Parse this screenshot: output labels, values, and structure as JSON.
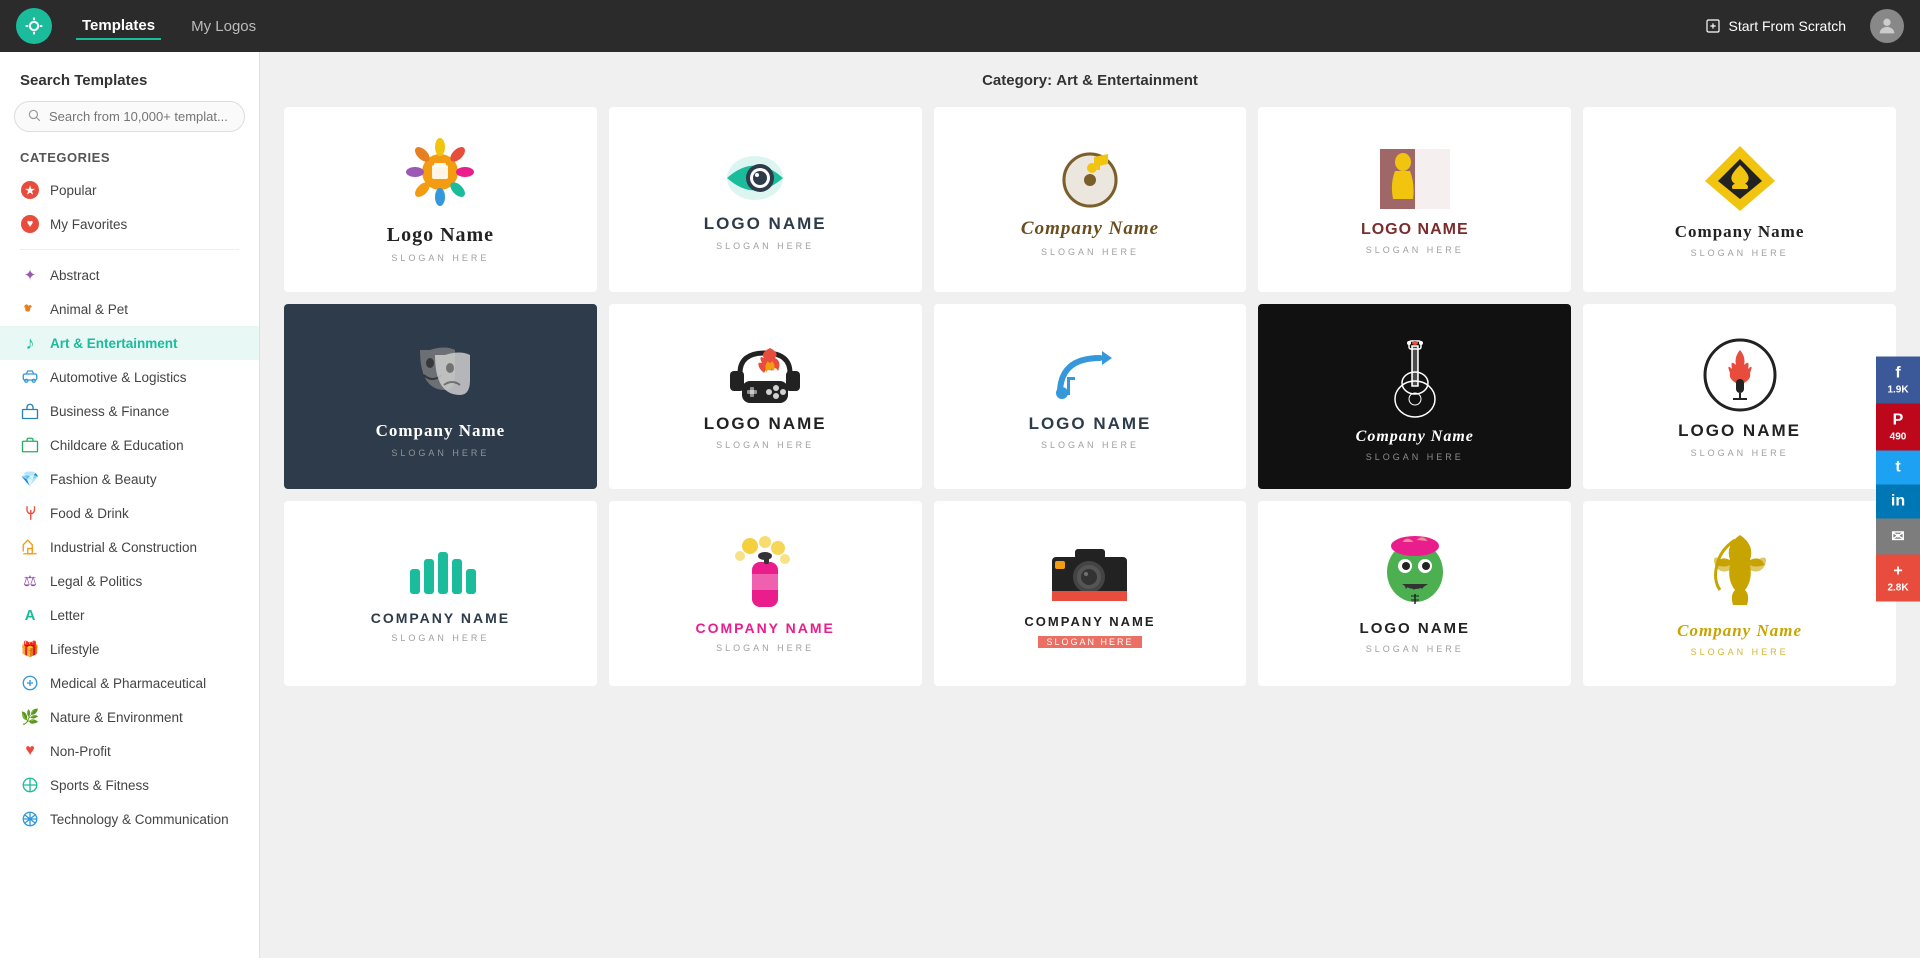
{
  "app": {
    "logo_icon": "◎",
    "nav_tabs": [
      {
        "label": "Templates",
        "active": true
      },
      {
        "label": "My Logos",
        "active": false
      }
    ],
    "start_scratch": "Start From Scratch"
  },
  "sidebar": {
    "search_title": "Search Templates",
    "search_placeholder": "Search from 10,000+ templat...",
    "categories_title": "Categories",
    "special_items": [
      {
        "label": "Popular",
        "type": "popular"
      },
      {
        "label": "My Favorites",
        "type": "favorite"
      }
    ],
    "categories": [
      {
        "label": "Abstract",
        "icon": "✦",
        "color": "#9b59b6"
      },
      {
        "label": "Animal & Pet",
        "icon": "🐾",
        "color": "#e67e22"
      },
      {
        "label": "Art & Entertainment",
        "icon": "♪",
        "color": "#1abc9c",
        "active": true
      },
      {
        "label": "Automotive & Logistics",
        "icon": "🚗",
        "color": "#3498db"
      },
      {
        "label": "Business & Finance",
        "icon": "💼",
        "color": "#2980b9"
      },
      {
        "label": "Childcare & Education",
        "icon": "🏫",
        "color": "#27ae60"
      },
      {
        "label": "Fashion & Beauty",
        "icon": "💎",
        "color": "#e91e8c"
      },
      {
        "label": "Food & Drink",
        "icon": "🍽",
        "color": "#e74c3c"
      },
      {
        "label": "Industrial & Construction",
        "icon": "🏗",
        "color": "#f39c12"
      },
      {
        "label": "Legal & Politics",
        "icon": "⚖",
        "color": "#8e44ad"
      },
      {
        "label": "Letter",
        "icon": "A",
        "color": "#1abc9c"
      },
      {
        "label": "Lifestyle",
        "icon": "🎁",
        "color": "#e74c3c"
      },
      {
        "label": "Medical & Pharmaceutical",
        "icon": "⚕",
        "color": "#3498db"
      },
      {
        "label": "Nature & Environment",
        "icon": "🌿",
        "color": "#27ae60"
      },
      {
        "label": "Non-Profit",
        "icon": "♥",
        "color": "#e74c3c"
      },
      {
        "label": "Sports & Fitness",
        "icon": "🌐",
        "color": "#1abc9c"
      },
      {
        "label": "Technology & Communication",
        "icon": "🌐",
        "color": "#3498db"
      }
    ]
  },
  "main": {
    "category_prefix": "Category:",
    "category_name": "Art & Entertainment",
    "templates": [
      {
        "id": 1,
        "bg": "#fff",
        "logo_name": "Logo Name",
        "slogan": "Slogan Here",
        "logo_name_color": "#222",
        "slogan_color": "#888",
        "has_icon": "paint-splat",
        "icon_colors": [
          "#f39c12",
          "#e74c3c",
          "#f1c40f",
          "#e91e8c",
          "#1abc9c"
        ]
      },
      {
        "id": 2,
        "bg": "#fff",
        "logo_name": "LOGO NAME",
        "slogan": "Slogan Here",
        "logo_name_color": "#2d3b4a",
        "slogan_color": "#888",
        "has_icon": "eye-camera",
        "icon_colors": [
          "#1abc9c",
          "#2d3b4a"
        ]
      },
      {
        "id": 3,
        "bg": "#fff",
        "logo_name": "Company Name",
        "slogan": "Slogan Here",
        "logo_name_color": "#6b4e1e",
        "slogan_color": "#888",
        "has_icon": "music-note",
        "icon_colors": [
          "#f1c40f",
          "#6b4e1e"
        ]
      },
      {
        "id": 4,
        "bg": "#fff",
        "logo_name": "LOGO NAME",
        "slogan": "Slogan Here",
        "logo_name_color": "#7b2d2d",
        "slogan_color": "#888",
        "has_icon": "silhouette",
        "icon_colors": [
          "#7b2d2d",
          "#f1c40f"
        ]
      },
      {
        "id": 5,
        "bg": "#fff",
        "logo_name": "Company Name",
        "slogan": "Slogan Here",
        "logo_name_color": "#222",
        "slogan_color": "#888",
        "has_icon": "diamond-spade",
        "icon_colors": [
          "#222",
          "#f1c40f"
        ]
      },
      {
        "id": 6,
        "bg": "#2d3b4a",
        "logo_name": "Company Name",
        "slogan": "Slogan Here",
        "logo_name_color": "#fff",
        "slogan_color": "#aaa",
        "has_icon": "theater-mask",
        "icon_colors": [
          "#fff",
          "#888"
        ]
      },
      {
        "id": 7,
        "bg": "#fff",
        "logo_name": "LOGO NAME",
        "slogan": "Slogan Here",
        "logo_name_color": "#222",
        "slogan_color": "#888",
        "has_icon": "gamepad",
        "icon_colors": [
          "#222"
        ]
      },
      {
        "id": 8,
        "bg": "#fff",
        "logo_name": "LOGO NAME",
        "slogan": "Slogan Here",
        "logo_name_color": "#2d3b4a",
        "slogan_color": "#888",
        "has_icon": "music-pencil",
        "icon_colors": [
          "#3498db",
          "#2d3b4a"
        ]
      },
      {
        "id": 9,
        "bg": "#111",
        "logo_name": "Company Name",
        "slogan": "slogan here",
        "logo_name_color": "#fff",
        "slogan_color": "#aaa",
        "has_icon": "guitar",
        "icon_colors": [
          "#fff",
          "#e74c3c"
        ]
      },
      {
        "id": 10,
        "bg": "#fff",
        "logo_name": "LOGO NAME",
        "slogan": "Slogan Here",
        "logo_name_color": "#222",
        "slogan_color": "#888",
        "has_icon": "microphone-circle",
        "icon_colors": [
          "#222",
          "#e74c3c"
        ]
      },
      {
        "id": 11,
        "bg": "#fff",
        "logo_name": "COMPANY NAME",
        "slogan": "Slogan Here",
        "logo_name_color": "#2d3b4a",
        "slogan_color": "#888",
        "has_icon": "audio-bars",
        "icon_colors": [
          "#1abc9c"
        ]
      },
      {
        "id": 12,
        "bg": "#fff",
        "logo_name": "COMPANY NAME",
        "slogan": "Slogan Here",
        "logo_name_color": "#e91e8c",
        "slogan_color": "#888",
        "has_icon": "spray-can",
        "icon_colors": [
          "#f1c40f",
          "#e91e8c"
        ]
      },
      {
        "id": 13,
        "bg": "#fff",
        "logo_name": "COMPANY NAME",
        "slogan": "Slogan Here",
        "logo_name_color": "#222",
        "slogan_color": "#fff",
        "slogan_bg": "#e74c3c",
        "has_icon": "camera",
        "icon_colors": [
          "#222",
          "#e74c3c"
        ]
      },
      {
        "id": 14,
        "bg": "#fff",
        "logo_name": "LOGO NAME",
        "slogan": "Slogan Here",
        "logo_name_color": "#222",
        "slogan_color": "#888",
        "has_icon": "zombie",
        "icon_colors": [
          "#4caf50",
          "#e91e8c",
          "#222"
        ]
      },
      {
        "id": 15,
        "bg": "#fff",
        "logo_name": "Company Name",
        "slogan": "Slogan Here",
        "logo_name_color": "#c8a400",
        "slogan_color": "#c8a400",
        "has_icon": "fairy-silhouette",
        "icon_colors": [
          "#c8a400"
        ]
      }
    ]
  },
  "social": [
    {
      "platform": "facebook",
      "label": "f",
      "count": "1.9K",
      "color": "#3b5998"
    },
    {
      "platform": "pinterest",
      "label": "P",
      "count": "490",
      "color": "#bd081c"
    },
    {
      "platform": "twitter",
      "label": "t",
      "count": "",
      "color": "#1da1f2"
    },
    {
      "platform": "linkedin",
      "label": "in",
      "count": "",
      "color": "#0077b5"
    },
    {
      "platform": "email",
      "label": "✉",
      "count": "",
      "color": "#7d7d7d"
    },
    {
      "platform": "plus",
      "label": "+",
      "count": "2.8K",
      "color": "#e74c3c"
    }
  ]
}
